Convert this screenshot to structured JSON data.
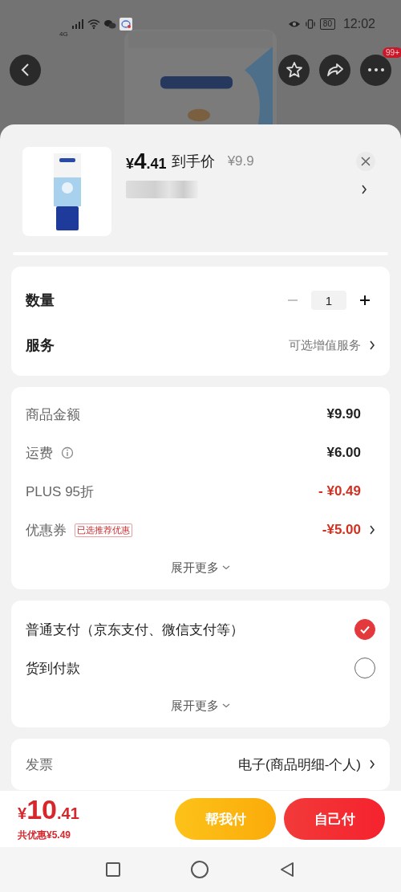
{
  "status_bar": {
    "network": "4G",
    "battery": "80",
    "time": "12:02"
  },
  "top_nav": {
    "badge": "99+"
  },
  "product": {
    "price_symbol": "¥",
    "price_int": "4",
    "price_dec": ".41",
    "price_label": "到手价",
    "original_price": "¥9.9"
  },
  "quantity": {
    "label": "数量",
    "value": "1",
    "minus_disabled": true
  },
  "service": {
    "label": "服务",
    "value": "可选增值服务"
  },
  "fees": [
    {
      "label": "商品金额",
      "value": "¥9.90",
      "discount": false,
      "info": false,
      "chevron": false
    },
    {
      "label": "运费",
      "value": "¥6.00",
      "discount": false,
      "info": true,
      "chevron": false
    },
    {
      "label": "PLUS 95折",
      "value": "- ¥0.49",
      "discount": true,
      "info": false,
      "chevron": false
    },
    {
      "label": "优惠券",
      "tag": "已选推荐优惠",
      "value": "-¥5.00",
      "discount": true,
      "info": false,
      "chevron": true
    }
  ],
  "fees_expand": "展开更多",
  "payment": [
    {
      "label": "普通支付（京东支付、微信支付等）",
      "selected": true
    },
    {
      "label": "货到付款",
      "selected": false
    }
  ],
  "payment_expand": "展开更多",
  "invoice": {
    "label": "发票",
    "value": "电子(商品明细-个人)"
  },
  "footer": {
    "total_symbol": "¥",
    "total_int": "10",
    "total_dec": ".41",
    "savings": "共优惠¥5.49",
    "buttons": [
      {
        "label": "帮我付",
        "kind": "secondary"
      },
      {
        "label": "自己付",
        "kind": "primary"
      }
    ]
  }
}
